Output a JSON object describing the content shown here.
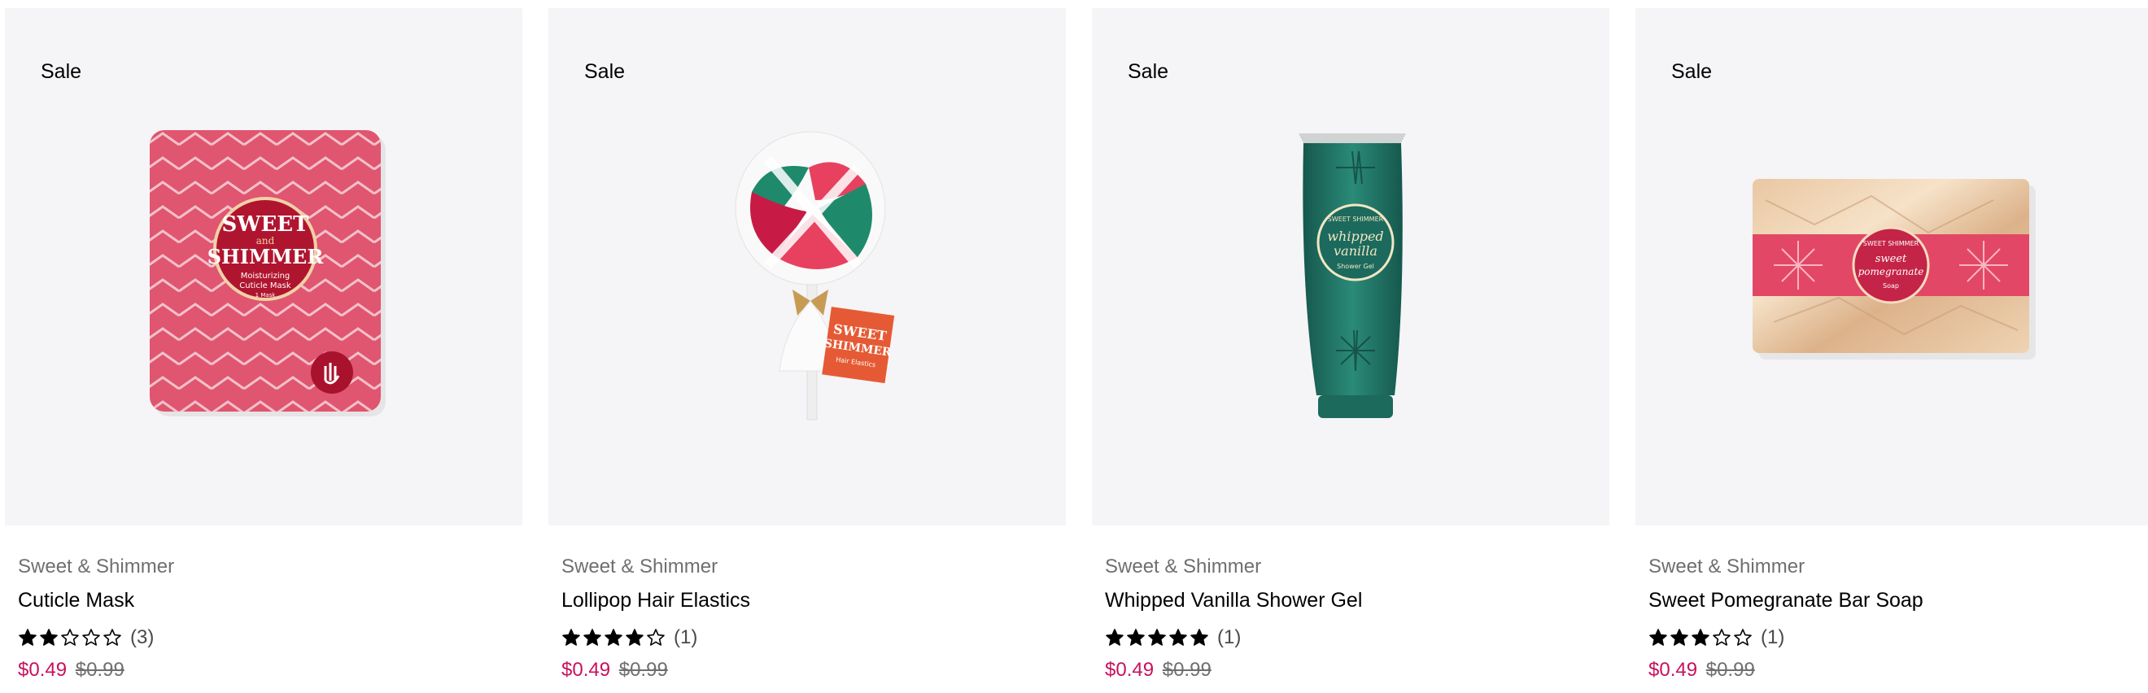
{
  "products": [
    {
      "badge": "Sale",
      "brand": "Sweet & Shimmer",
      "name": "Cuticle Mask",
      "rating": 2,
      "rating_max": 5,
      "review_count": "(3)",
      "sale_price": "$0.49",
      "original_price": "$0.99",
      "image_icon": "cuticle-mask-packet",
      "package_text": [
        "SWEET",
        "and",
        "SHIMMER",
        "Moisturizing",
        "Cuticle Mask",
        "1 Mask"
      ]
    },
    {
      "badge": "Sale",
      "brand": "Sweet & Shimmer",
      "name": "Lollipop Hair Elastics",
      "rating": 4,
      "rating_max": 5,
      "review_count": "(1)",
      "sale_price": "$0.49",
      "original_price": "$0.99",
      "image_icon": "lollipop-hair-elastics",
      "package_text": [
        "SWEET",
        "SHIMMER",
        "Hair Elastics"
      ]
    },
    {
      "badge": "Sale",
      "brand": "Sweet & Shimmer",
      "name": "Whipped Vanilla Shower Gel",
      "rating": 5,
      "rating_max": 5,
      "review_count": "(1)",
      "sale_price": "$0.49",
      "original_price": "$0.99",
      "image_icon": "shower-gel-tube",
      "package_text": [
        "SWEET SHIMMER",
        "whipped",
        "vanilla",
        "Shower Gel"
      ]
    },
    {
      "badge": "Sale",
      "brand": "Sweet & Shimmer",
      "name": "Sweet Pomegranate Bar Soap",
      "rating": 3,
      "rating_max": 5,
      "review_count": "(1)",
      "sale_price": "$0.49",
      "original_price": "$0.99",
      "image_icon": "bar-soap-wrapped",
      "package_text": [
        "SWEET SHIMMER",
        "sweet",
        "pomegranate",
        "Soap"
      ]
    }
  ],
  "colors": {
    "sale_price": "#c8115c",
    "image_bg": "#f5f4f6",
    "brand_text": "#6f6f6f"
  }
}
